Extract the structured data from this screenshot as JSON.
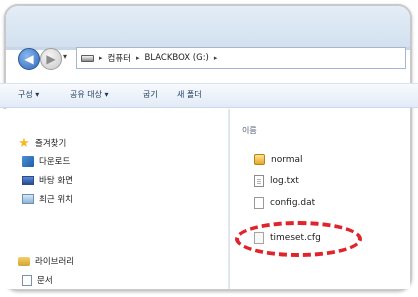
{
  "address_bar": {
    "crumbs": [
      "컴퓨터",
      "BLACKBOX (G:)"
    ],
    "separator": "▸",
    "dropdown": "▾"
  },
  "toolbar": {
    "organize": "구성 ▾",
    "share": "공유 대상 ▾",
    "burn": "굽기",
    "new_folder": "새 폴더"
  },
  "navigation": {
    "favorites": "즐겨찾기",
    "downloads": "다운로드",
    "desktop": "바탕 화면",
    "recent": "최근 위치",
    "libraries": "라이브러리",
    "documents": "문서"
  },
  "content": {
    "column_header": "이름",
    "files": [
      "normal",
      "log.txt",
      "config.dat",
      "timeset.cfg"
    ]
  },
  "colors": {
    "highlight": "#e0242b"
  }
}
